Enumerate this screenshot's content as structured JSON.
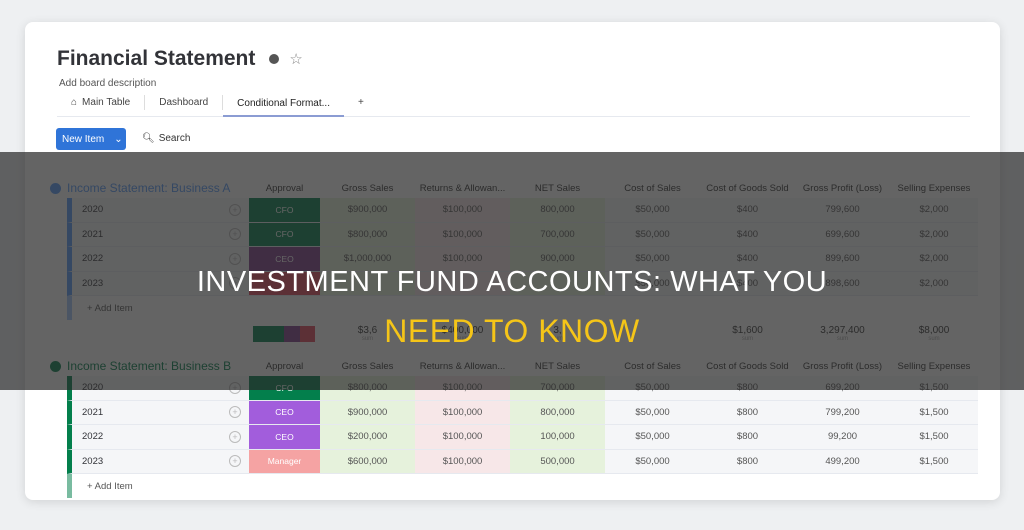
{
  "board": {
    "title": "Financial Statement",
    "description": "Add board description"
  },
  "tabs": [
    {
      "label": "Main Table",
      "icon": "home-icon"
    },
    {
      "label": "Dashboard"
    },
    {
      "label": "Conditional Format..."
    },
    {
      "label": "+"
    }
  ],
  "toolbar": {
    "new_item": "New Item",
    "search": "Search"
  },
  "columns": [
    "Approval",
    "Gross Sales",
    "Returns & Allowan...",
    "NET Sales",
    "Cost of Sales",
    "Cost of Goods Sold",
    "Gross Profit (Loss)",
    "Selling Expenses"
  ],
  "groups": [
    {
      "title": "Income Statement: Business A",
      "color": "#579bfc",
      "add_item": "+ Add Item",
      "rows": [
        {
          "name": "2020",
          "approval": "CFO",
          "approval_color": "#037f4c",
          "cells": [
            "$900,000",
            "$100,000",
            "800,000",
            "$50,000",
            "$400",
            "799,600",
            "$2,000"
          ]
        },
        {
          "name": "2021",
          "approval": "CFO",
          "approval_color": "#037f4c",
          "cells": [
            "$800,000",
            "$100,000",
            "700,000",
            "$50,000",
            "$400",
            "699,600",
            "$2,000"
          ]
        },
        {
          "name": "2022",
          "approval": "CEO",
          "approval_color": "#7e3b8a",
          "cells": [
            "$1,000,000",
            "$100,000",
            "900,000",
            "$50,000",
            "$400",
            "899,600",
            "$2,000"
          ]
        },
        {
          "name": "2023",
          "approval": "",
          "approval_color": "#e2445c",
          "cells": [
            "",
            "",
            "",
            "$50,000",
            "$400",
            "898,600",
            "$2,000"
          ]
        }
      ],
      "summary": {
        "values": [
          "$3,6",
          "$400,000",
          "3,",
          "",
          "$1,600",
          "3,297,400",
          "$8,000"
        ],
        "label": "sum"
      }
    },
    {
      "title": "Income Statement: Business B",
      "color": "#037f4c",
      "add_item": "+ Add Item",
      "rows": [
        {
          "name": "2020",
          "approval": "CFO",
          "approval_color": "#037f4c",
          "cells": [
            "$800,000",
            "$100,000",
            "700,000",
            "$50,000",
            "$800",
            "699,200",
            "$1,500"
          ]
        },
        {
          "name": "2021",
          "approval": "CEO",
          "approval_color": "#a25ddc",
          "cells": [
            "$900,000",
            "$100,000",
            "800,000",
            "$50,000",
            "$800",
            "799,200",
            "$1,500"
          ]
        },
        {
          "name": "2022",
          "approval": "CEO",
          "approval_color": "#a25ddc",
          "cells": [
            "$200,000",
            "$100,000",
            "100,000",
            "$50,000",
            "$800",
            "99,200",
            "$1,500"
          ]
        },
        {
          "name": "2023",
          "approval": "Manager",
          "approval_color": "#f5a3a3",
          "cells": [
            "$600,000",
            "$100,000",
            "500,000",
            "$50,000",
            "$800",
            "499,200",
            "$1,500"
          ]
        }
      ]
    }
  ],
  "overlay": {
    "line1": "INVESTMENT FUND ACCOUNTS: WHAT YOU",
    "line2": "NEED TO KNOW",
    "line1_color": "#ffffff",
    "line2_color": "#f5c518"
  }
}
